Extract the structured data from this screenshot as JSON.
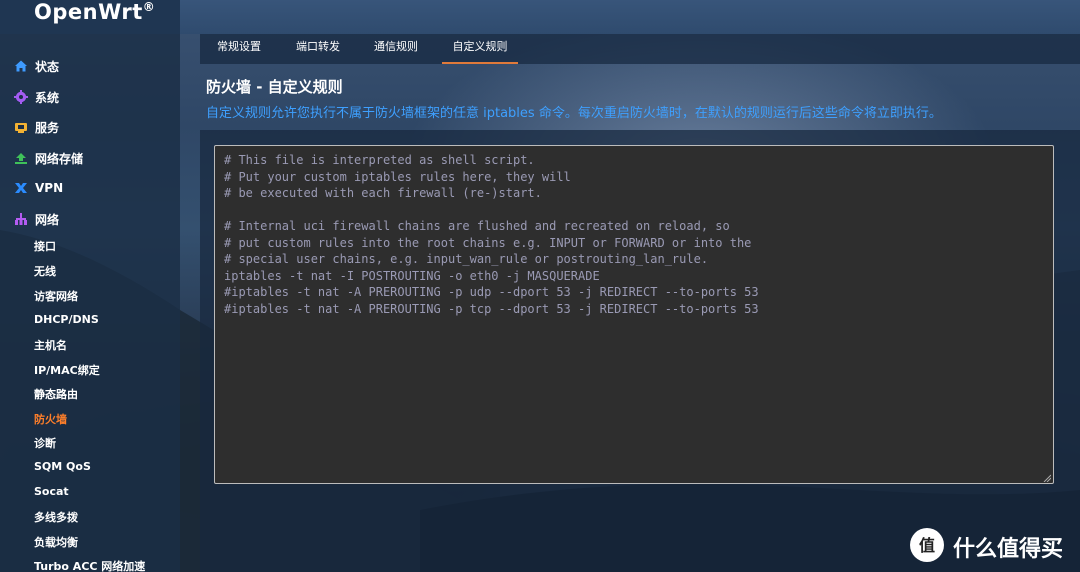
{
  "header": {
    "brand": "OpenWrt",
    "brand_mark": "®"
  },
  "sidebar": {
    "main_items": [
      {
        "label": "状态",
        "icon": "home-icon",
        "color": "#3e9bff"
      },
      {
        "label": "系统",
        "icon": "gear-icon",
        "color": "#a35cf2"
      },
      {
        "label": "服务",
        "icon": "service-icon",
        "color": "#f2b233"
      },
      {
        "label": "网络存储",
        "icon": "storage-icon",
        "color": "#3fc15a"
      },
      {
        "label": "VPN",
        "icon": "vpn-icon",
        "color": "#2b8cff"
      },
      {
        "label": "网络",
        "icon": "network-icon",
        "color": "#b45cf2"
      }
    ],
    "sub_items": [
      {
        "label": "接口"
      },
      {
        "label": "无线"
      },
      {
        "label": "访客网络"
      },
      {
        "label": "DHCP/DNS"
      },
      {
        "label": "主机名"
      },
      {
        "label": "IP/MAC绑定"
      },
      {
        "label": "静态路由"
      },
      {
        "label": "防火墙",
        "active": true
      },
      {
        "label": "诊断"
      },
      {
        "label": "SQM QoS"
      },
      {
        "label": "Socat"
      },
      {
        "label": "多线多拨"
      },
      {
        "label": "负载均衡"
      },
      {
        "label": "Turbo ACC 网络加速"
      }
    ]
  },
  "tabs": [
    {
      "label": "常规设置"
    },
    {
      "label": "端口转发"
    },
    {
      "label": "通信规则"
    },
    {
      "label": "自定义规则",
      "active": true
    }
  ],
  "page": {
    "title": "防火墙 - 自定义规则",
    "description": "自定义规则允许您执行不属于防火墙框架的任意 iptables 命令。每次重启防火墙时，在默认的规则运行后这些命令将立即执行。"
  },
  "editor": {
    "content": "# This file is interpreted as shell script.\n# Put your custom iptables rules here, they will\n# be executed with each firewall (re-)start.\n\n# Internal uci firewall chains are flushed and recreated on reload, so\n# put custom rules into the root chains e.g. INPUT or FORWARD or into the\n# special user chains, e.g. input_wan_rule or postrouting_lan_rule.\niptables -t nat -I POSTROUTING -o eth0 -j MASQUERADE\n#iptables -t nat -A PREROUTING -p udp --dport 53 -j REDIRECT --to-ports 53\n#iptables -t nat -A PREROUTING -p tcp --dport 53 -j REDIRECT --to-ports 53"
  },
  "watermark": {
    "text": "什么值得买",
    "icon": "smzdm-logo-icon"
  },
  "colors": {
    "accent_active": "#ff7f2a",
    "description": "#3ea0ff"
  }
}
